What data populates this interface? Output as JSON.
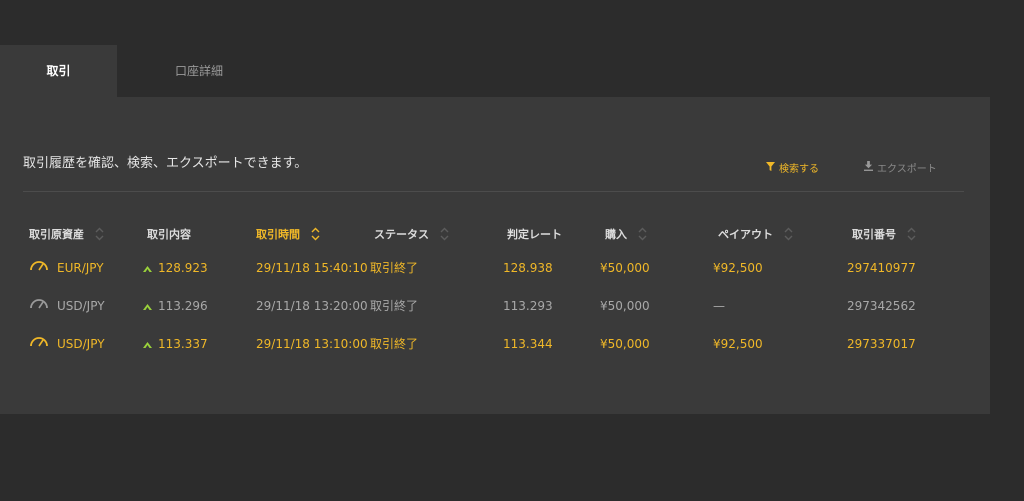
{
  "tabs": [
    {
      "label": "取引"
    },
    {
      "label": "口座詳細"
    }
  ],
  "panel": {
    "description": "取引履歴を確認、検索、エクスポートできます。",
    "search_label": "検索する",
    "export_label": "エクスポート"
  },
  "columns": [
    {
      "label": "取引原資産",
      "sortable": true
    },
    {
      "label": "取引内容",
      "sortable": false
    },
    {
      "label": "取引時間",
      "sortable": true,
      "active": true
    },
    {
      "label": "ステータス",
      "sortable": true
    },
    {
      "label": "判定レート",
      "sortable": false
    },
    {
      "label": "購入",
      "sortable": true
    },
    {
      "label": "ペイアウト",
      "sortable": true
    },
    {
      "label": "取引番号",
      "sortable": true
    }
  ],
  "rows": [
    {
      "asset": "EUR/JPY",
      "rate": "128.923",
      "time": "29/11/18 15:40:10",
      "status": "取引終了",
      "judge_rate": "128.938",
      "purchase": "¥50,000",
      "payout": "¥92,500",
      "trade_no": "297410977",
      "result": "win"
    },
    {
      "asset": "USD/JPY",
      "rate": "113.296",
      "time": "29/11/18 13:20:00",
      "status": "取引終了",
      "judge_rate": "113.293",
      "purchase": "¥50,000",
      "payout": "—",
      "trade_no": "297342562",
      "result": "lose"
    },
    {
      "asset": "USD/JPY",
      "rate": "113.337",
      "time": "29/11/18 13:10:00",
      "status": "取引終了",
      "judge_rate": "113.344",
      "purchase": "¥50,000",
      "payout": "¥92,500",
      "trade_no": "297337017",
      "result": "win"
    }
  ],
  "colors": {
    "accent": "#f0b828",
    "up_arrow": "#9ad23a",
    "lose_text": "#a8a8a8",
    "panel_bg": "#3a3a3a",
    "page_bg": "#2c2c2c"
  },
  "icons": {
    "asset": "gauge-icon",
    "direction": "up-arrow-icon",
    "search": "filter-icon",
    "export": "download-icon",
    "sort": "sort-icon"
  }
}
